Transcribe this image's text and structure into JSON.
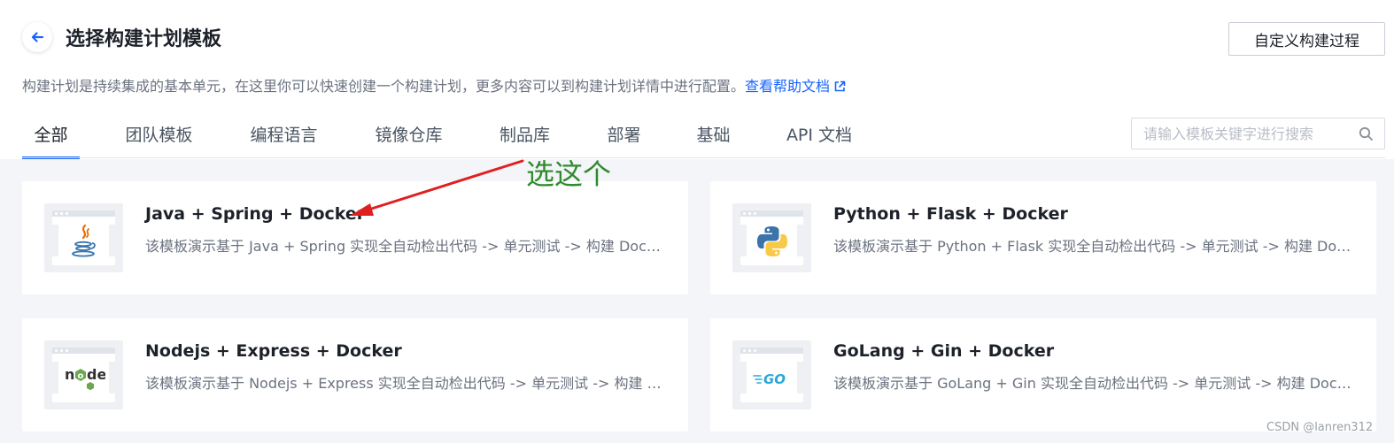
{
  "header": {
    "title": "选择构建计划模板",
    "custom_button_label": "自定义构建过程"
  },
  "description": {
    "text": "构建计划是持续集成的基本单元，在这里你可以快速创建一个构建计划，更多内容可以到构建计划详情中进行配置。",
    "help_link_label": "查看帮助文档"
  },
  "tabs": [
    {
      "label": "全部",
      "active": true
    },
    {
      "label": "团队模板"
    },
    {
      "label": "编程语言"
    },
    {
      "label": "镜像仓库"
    },
    {
      "label": "制品库"
    },
    {
      "label": "部署"
    },
    {
      "label": "基础"
    },
    {
      "label": "API 文档"
    }
  ],
  "search": {
    "placeholder": "请输入模板关键字进行搜索"
  },
  "templates": [
    {
      "title": "Java + Spring + Docker",
      "description": "该模板演示基于 Java + Spring 实现全自动检出代码 -> 单元测试 -> 构建 Docker 镜像",
      "icon": "java-icon"
    },
    {
      "title": "Python + Flask + Docker",
      "description": "该模板演示基于 Python + Flask 实现全自动检出代码 -> 单元测试 -> 构建 Docker 镜像",
      "icon": "python-icon"
    },
    {
      "title": "Nodejs + Express + Docker",
      "description": "该模板演示基于 Nodejs + Express 实现全自动检出代码 -> 单元测试 -> 构建 Docker 镜像",
      "icon": "nodejs-icon"
    },
    {
      "title": "GoLang + Gin + Docker",
      "description": "该模板演示基于 GoLang + Gin 实现全自动检出代码 -> 单元测试 -> 构建 Docker 镜像",
      "icon": "go-icon"
    }
  ],
  "annotation": {
    "text": "选这个"
  },
  "watermark": "CSDN @lanren312",
  "colors": {
    "accent": "#1664ff",
    "annotation": "#2e8b2e",
    "arrow": "#e02020"
  }
}
